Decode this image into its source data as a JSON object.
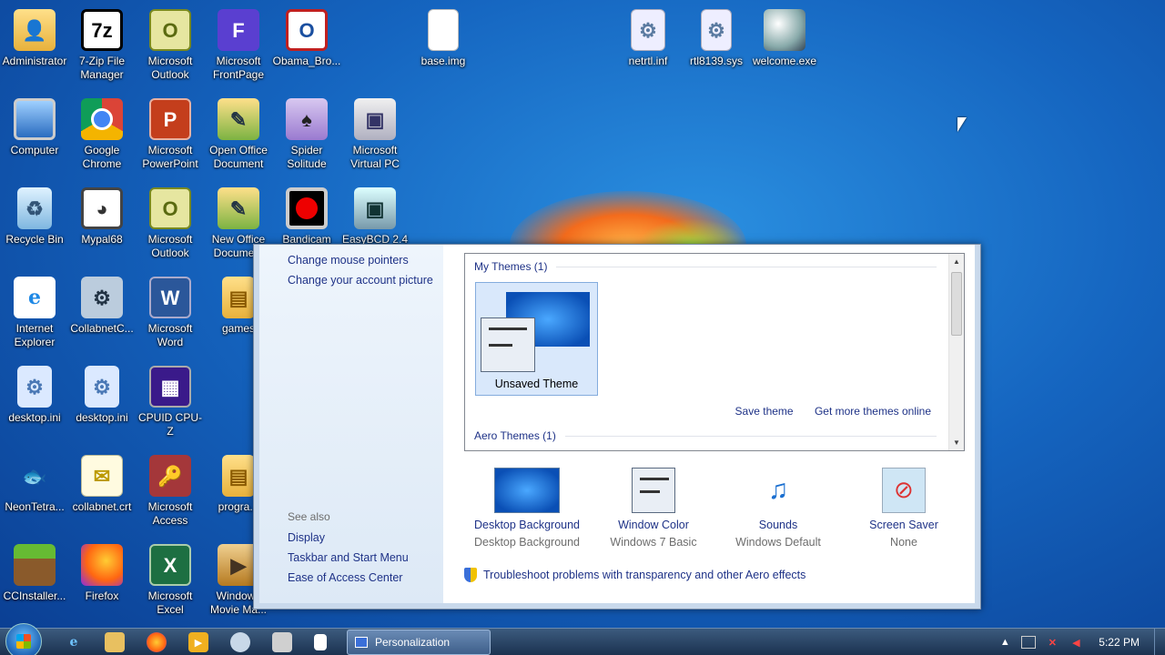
{
  "desktop": {
    "icons": [
      {
        "label": "Administrator",
        "glyph": "👤"
      },
      {
        "label": "7-Zip File Manager",
        "glyph": "7z"
      },
      {
        "label": "Microsoft Outlook",
        "glyph": "O"
      },
      {
        "label": "Microsoft FrontPage",
        "glyph": "F"
      },
      {
        "label": "Obama_Bro...",
        "glyph": "O"
      },
      {
        "label": "base.img",
        "glyph": ""
      },
      {
        "label": "netrtl.inf",
        "glyph": "⚙"
      },
      {
        "label": "rtl8139.sys",
        "glyph": "⚙"
      },
      {
        "label": "welcome.exe",
        "glyph": ""
      },
      {
        "label": "Computer",
        "glyph": ""
      },
      {
        "label": "Google Chrome",
        "glyph": ""
      },
      {
        "label": "Microsoft PowerPoint",
        "glyph": "P"
      },
      {
        "label": "Open Office Document",
        "glyph": "✎"
      },
      {
        "label": "Spider Solitude",
        "glyph": "♠"
      },
      {
        "label": "Microsoft Virtual PC",
        "glyph": "▣"
      },
      {
        "label": "Recycle Bin",
        "glyph": "♻"
      },
      {
        "label": "Mypal68",
        "glyph": "◕"
      },
      {
        "label": "Microsoft Outlook",
        "glyph": "O"
      },
      {
        "label": "New Office Docume...",
        "glyph": "✎"
      },
      {
        "label": "Bandicam",
        "glyph": ""
      },
      {
        "label": "EasyBCD 2.4",
        "glyph": "▣"
      },
      {
        "label": "Internet Explorer",
        "glyph": "e"
      },
      {
        "label": "CollabnetC...",
        "glyph": "⚙"
      },
      {
        "label": "Microsoft Word",
        "glyph": "W"
      },
      {
        "label": "games",
        "glyph": "▤"
      },
      {
        "label": "desktop.ini",
        "glyph": "⚙"
      },
      {
        "label": "desktop.ini",
        "glyph": "⚙"
      },
      {
        "label": "CPUID CPU-Z",
        "glyph": "▦"
      },
      {
        "label": "NeonTetra...",
        "glyph": "🐟"
      },
      {
        "label": "collabnet.crt",
        "glyph": "✉"
      },
      {
        "label": "Microsoft Access",
        "glyph": "🔑"
      },
      {
        "label": "progra...",
        "glyph": "▤"
      },
      {
        "label": "CCInstaller...",
        "glyph": ""
      },
      {
        "label": "Firefox",
        "glyph": ""
      },
      {
        "label": "Microsoft Excel",
        "glyph": "X"
      },
      {
        "label": "Windows Movie Ma...",
        "glyph": "▶"
      }
    ]
  },
  "window": {
    "title": "Personalization",
    "left_links": [
      "Change mouse pointers",
      "Change your account picture"
    ],
    "see_also_label": "See also",
    "see_also_links": [
      "Display",
      "Taskbar and Start Menu",
      "Ease of Access Center"
    ],
    "themes": {
      "my_themes_header": "My Themes (1)",
      "selected_theme_name": "Unsaved Theme",
      "save_theme": "Save theme",
      "get_more": "Get more themes online",
      "aero_header": "Aero Themes (1)"
    },
    "settings": [
      {
        "title": "Desktop Background",
        "sub": "Desktop Background"
      },
      {
        "title": "Window Color",
        "sub": "Windows 7 Basic"
      },
      {
        "title": "Sounds",
        "sub": "Windows Default"
      },
      {
        "title": "Screen Saver",
        "sub": "None"
      }
    ],
    "troubleshoot": "Troubleshoot problems with transparency and other Aero effects"
  },
  "taskbar": {
    "task_label": "Personalization",
    "clock": "5:22 PM",
    "tray_up_arrow": "▲",
    "pinned": [
      "ie-icon",
      "explorer-icon",
      "firefox-icon",
      "media-player-icon",
      "network-icon",
      "app-icon",
      "app-icon-2"
    ]
  }
}
